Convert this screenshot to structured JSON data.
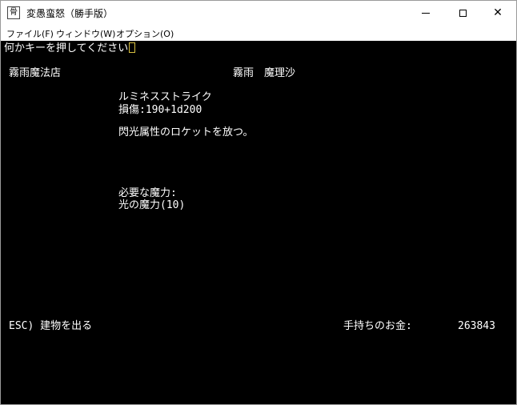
{
  "window": {
    "title": "変愚蛮怒（勝手版）",
    "icon": "app-icon",
    "icon_glyph": "骨",
    "controls": {
      "minimize": "minimize-icon",
      "maximize": "maximize-icon",
      "close_glyph": "✕"
    }
  },
  "menu": [
    {
      "label": "ファイル(F)"
    },
    {
      "label": "ウィンドウ(W)"
    },
    {
      "label": "オプション(O)"
    }
  ],
  "terminal": {
    "prompt": "何かキーを押してください",
    "shop_name": "霧雨魔法店",
    "owner": "霧雨　魔理沙",
    "spell_name": "ルミネスストライク",
    "damage": "損傷:190+1d200",
    "description": "閃光属性のロケットを放つ。",
    "requirement_heading": "必要な魔力:",
    "requirement_value": "光の魔力(10)",
    "exit_command": "ESC) 建物を出る",
    "gold_label": "手持ちのお金:",
    "gold_amount": "263843"
  }
}
